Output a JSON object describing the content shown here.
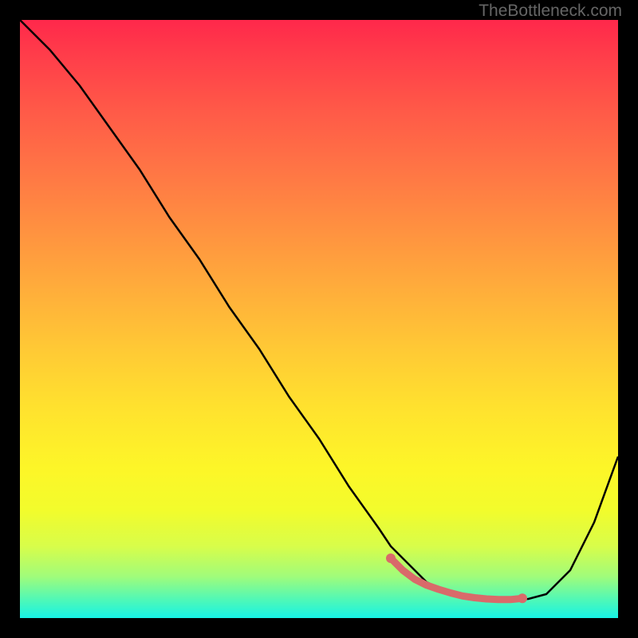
{
  "watermark": "TheBottleneck.com",
  "chart_data": {
    "type": "line",
    "title": "",
    "xlabel": "",
    "ylabel": "",
    "xlim": [
      0,
      100
    ],
    "ylim": [
      0,
      100
    ],
    "series": [
      {
        "name": "bottleneck-curve",
        "x": [
          0,
          5,
          10,
          15,
          20,
          25,
          30,
          35,
          40,
          45,
          50,
          55,
          60,
          62,
          64,
          66,
          68,
          70,
          72,
          74,
          76,
          78,
          80,
          82,
          85,
          88,
          92,
          96,
          100
        ],
        "y": [
          100,
          95,
          89,
          82,
          75,
          67,
          60,
          52,
          45,
          37,
          30,
          22,
          15,
          12,
          10,
          8,
          6,
          5,
          4.2,
          3.6,
          3.2,
          3.1,
          3,
          3,
          3.2,
          4,
          8,
          16,
          27
        ]
      }
    ],
    "highlight_band": {
      "name": "optimal-range",
      "x": [
        62,
        64,
        66,
        68,
        70,
        72,
        74,
        76,
        78,
        80,
        82,
        84
      ],
      "y": [
        10,
        8,
        6.5,
        5.5,
        4.8,
        4.2,
        3.7,
        3.4,
        3.2,
        3.1,
        3.1,
        3.3
      ],
      "color": "#d96a6a"
    }
  }
}
